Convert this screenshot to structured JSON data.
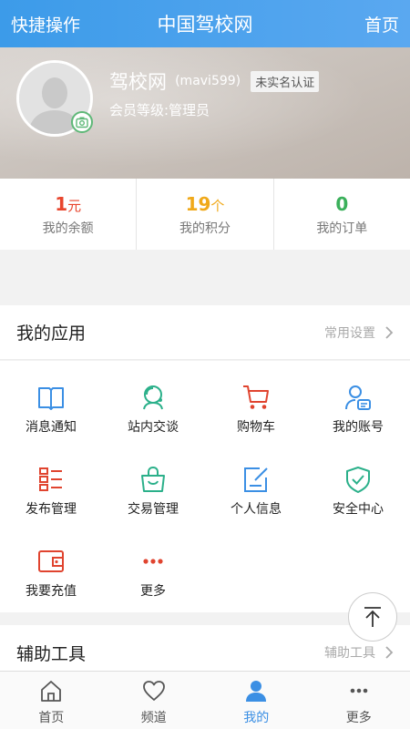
{
  "header": {
    "left": "快捷操作",
    "title": "中国驾校网",
    "right": "首页"
  },
  "profile": {
    "name": "驾校网",
    "id": "(mavi599)",
    "verify_badge": "未实名认证",
    "level": "会员等级:管理员"
  },
  "stats": [
    {
      "value": "1",
      "unit": "元",
      "label": "我的余额",
      "color": "#e8452d"
    },
    {
      "value": "19",
      "unit": "个",
      "label": "我的积分",
      "color": "#f0a91a"
    },
    {
      "value": "0",
      "unit": "",
      "label": "我的订单",
      "color": "#3bb05b"
    }
  ],
  "my_apps": {
    "title": "我的应用",
    "link": "常用设置",
    "items": [
      {
        "label": "消息通知",
        "icon": "book-icon",
        "color": "#3b8fe4"
      },
      {
        "label": "站内交谈",
        "icon": "chat-person-icon",
        "color": "#2bb08a"
      },
      {
        "label": "购物车",
        "icon": "cart-icon",
        "color": "#e0442f"
      },
      {
        "label": "我的账号",
        "icon": "account-icon",
        "color": "#3b8fe4"
      },
      {
        "label": "发布管理",
        "icon": "list-icon",
        "color": "#e0442f"
      },
      {
        "label": "交易管理",
        "icon": "bag-icon",
        "color": "#2bb08a"
      },
      {
        "label": "个人信息",
        "icon": "edit-icon",
        "color": "#3b8fe4"
      },
      {
        "label": "安全中心",
        "icon": "shield-icon",
        "color": "#2bb08a"
      },
      {
        "label": "我要充值",
        "icon": "wallet-icon",
        "color": "#e0442f"
      },
      {
        "label": "更多",
        "icon": "dots-icon",
        "color": "#e0442f"
      }
    ]
  },
  "tools": {
    "title": "辅助工具",
    "link": "辅助工具"
  },
  "tabbar": [
    {
      "label": "首页",
      "icon": "home-icon",
      "active": false
    },
    {
      "label": "频道",
      "icon": "heart-icon",
      "active": false
    },
    {
      "label": "我的",
      "icon": "user-icon",
      "active": true
    },
    {
      "label": "更多",
      "icon": "more-dots-icon",
      "active": false
    }
  ]
}
